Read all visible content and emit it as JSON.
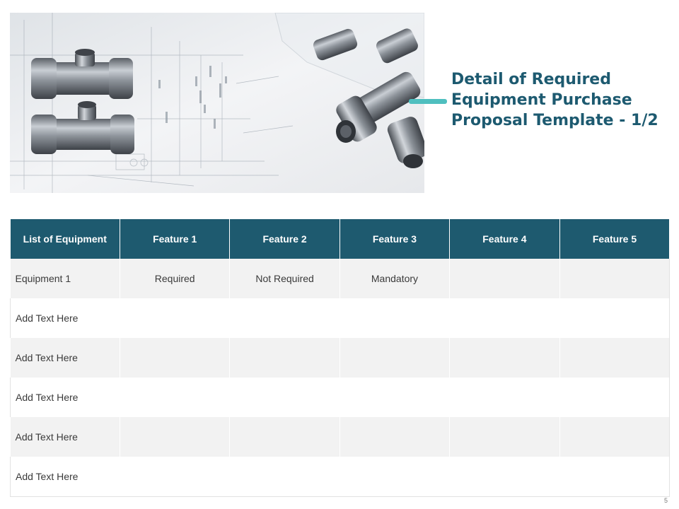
{
  "slide": {
    "title": "Detail of Required Equipment Purchase Proposal Template - 1/2",
    "page_number": "5",
    "accent_color": "#4fbfbf",
    "title_color": "#1d5a70",
    "header_color": "#1e5a6f"
  },
  "photo": {
    "subject": "pipe-fittings-on-blueprint"
  },
  "table": {
    "headers": [
      "List of Equipment",
      "Feature 1",
      "Feature 2",
      "Feature 3",
      "Feature 4",
      "Feature 5"
    ],
    "rows": [
      [
        "Equipment 1",
        "Required",
        "Not Required",
        "Mandatory",
        "",
        ""
      ],
      [
        "Add Text Here",
        "",
        "",
        "",
        "",
        ""
      ],
      [
        "Add Text Here",
        "",
        "",
        "",
        "",
        ""
      ],
      [
        "Add Text Here",
        "",
        "",
        "",
        "",
        ""
      ],
      [
        "Add Text Here",
        "",
        "",
        "",
        "",
        ""
      ],
      [
        "Add Text Here",
        "",
        "",
        "",
        "",
        ""
      ]
    ]
  }
}
